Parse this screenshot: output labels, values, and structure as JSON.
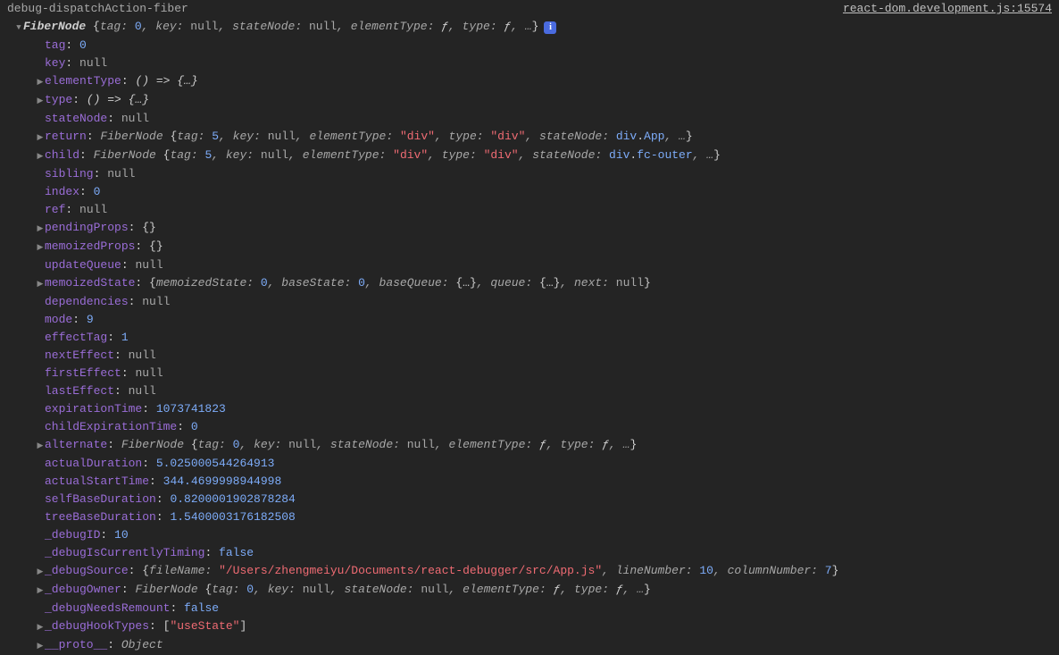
{
  "header": {
    "label": "debug-dispatchAction-fiber",
    "source": "react-dom.development.js:15574"
  },
  "root": {
    "cls": "FiberNode",
    "summary": [
      {
        "k": "tag",
        "t": "num",
        "v": "0"
      },
      {
        "k": "key",
        "t": "null",
        "v": "null"
      },
      {
        "k": "stateNode",
        "t": "null",
        "v": "null"
      },
      {
        "k": "elementType",
        "t": "fnsym",
        "v": "ƒ"
      },
      {
        "k": "type",
        "t": "fnsym",
        "v": "ƒ"
      },
      {
        "k": null,
        "t": "more",
        "v": "…"
      }
    ]
  },
  "props": [
    {
      "tri": "",
      "key": "tag",
      "value": [
        {
          "t": "num",
          "v": "0"
        }
      ]
    },
    {
      "tri": "",
      "key": "key",
      "value": [
        {
          "t": "null",
          "v": "null"
        }
      ]
    },
    {
      "tri": "▶",
      "key": "elementType",
      "value": [
        {
          "t": "fn",
          "v": "() => {…}"
        }
      ]
    },
    {
      "tri": "▶",
      "key": "type",
      "value": [
        {
          "t": "fn",
          "v": "() => {…}"
        }
      ]
    },
    {
      "tri": "",
      "key": "stateNode",
      "value": [
        {
          "t": "null",
          "v": "null"
        }
      ]
    },
    {
      "tri": "▶",
      "key": "return",
      "value": [
        {
          "t": "preview",
          "v": "FiberNode "
        },
        {
          "t": "punct",
          "v": "{"
        },
        {
          "t": "preview",
          "v": "tag: "
        },
        {
          "t": "num",
          "v": "5"
        },
        {
          "t": "preview",
          "v": ", key: "
        },
        {
          "t": "null",
          "v": "null"
        },
        {
          "t": "preview",
          "v": ", elementType: "
        },
        {
          "t": "str",
          "v": "\"div\""
        },
        {
          "t": "preview",
          "v": ", type: "
        },
        {
          "t": "str",
          "v": "\"div\""
        },
        {
          "t": "preview",
          "v": ", stateNode: "
        },
        {
          "t": "elem",
          "v": "div"
        },
        {
          "t": "punct",
          "v": "."
        },
        {
          "t": "cls",
          "v": "App"
        },
        {
          "t": "preview",
          "v": ", …"
        },
        {
          "t": "punct",
          "v": "}"
        }
      ]
    },
    {
      "tri": "▶",
      "key": "child",
      "value": [
        {
          "t": "preview",
          "v": "FiberNode "
        },
        {
          "t": "punct",
          "v": "{"
        },
        {
          "t": "preview",
          "v": "tag: "
        },
        {
          "t": "num",
          "v": "5"
        },
        {
          "t": "preview",
          "v": ", key: "
        },
        {
          "t": "null",
          "v": "null"
        },
        {
          "t": "preview",
          "v": ", elementType: "
        },
        {
          "t": "str",
          "v": "\"div\""
        },
        {
          "t": "preview",
          "v": ", type: "
        },
        {
          "t": "str",
          "v": "\"div\""
        },
        {
          "t": "preview",
          "v": ", stateNode: "
        },
        {
          "t": "elem",
          "v": "div"
        },
        {
          "t": "punct",
          "v": "."
        },
        {
          "t": "cls",
          "v": "fc-outer"
        },
        {
          "t": "preview",
          "v": ", …"
        },
        {
          "t": "punct",
          "v": "}"
        }
      ]
    },
    {
      "tri": "",
      "key": "sibling",
      "value": [
        {
          "t": "null",
          "v": "null"
        }
      ]
    },
    {
      "tri": "",
      "key": "index",
      "value": [
        {
          "t": "num",
          "v": "0"
        }
      ]
    },
    {
      "tri": "",
      "key": "ref",
      "value": [
        {
          "t": "null",
          "v": "null"
        }
      ]
    },
    {
      "tri": "▶",
      "key": "pendingProps",
      "value": [
        {
          "t": "punct",
          "v": "{}"
        }
      ]
    },
    {
      "tri": "▶",
      "key": "memoizedProps",
      "value": [
        {
          "t": "punct",
          "v": "{}"
        }
      ]
    },
    {
      "tri": "",
      "key": "updateQueue",
      "value": [
        {
          "t": "null",
          "v": "null"
        }
      ]
    },
    {
      "tri": "▶",
      "key": "memoizedState",
      "value": [
        {
          "t": "punct",
          "v": "{"
        },
        {
          "t": "preview",
          "v": "memoizedState: "
        },
        {
          "t": "num",
          "v": "0"
        },
        {
          "t": "preview",
          "v": ", baseState: "
        },
        {
          "t": "num",
          "v": "0"
        },
        {
          "t": "preview",
          "v": ", baseQueue: "
        },
        {
          "t": "punct",
          "v": "{…}"
        },
        {
          "t": "preview",
          "v": ", queue: "
        },
        {
          "t": "punct",
          "v": "{…}"
        },
        {
          "t": "preview",
          "v": ", next: "
        },
        {
          "t": "null",
          "v": "null"
        },
        {
          "t": "punct",
          "v": "}"
        }
      ]
    },
    {
      "tri": "",
      "key": "dependencies",
      "value": [
        {
          "t": "null",
          "v": "null"
        }
      ]
    },
    {
      "tri": "",
      "key": "mode",
      "value": [
        {
          "t": "num",
          "v": "9"
        }
      ]
    },
    {
      "tri": "",
      "key": "effectTag",
      "value": [
        {
          "t": "num",
          "v": "1"
        }
      ]
    },
    {
      "tri": "",
      "key": "nextEffect",
      "value": [
        {
          "t": "null",
          "v": "null"
        }
      ]
    },
    {
      "tri": "",
      "key": "firstEffect",
      "value": [
        {
          "t": "null",
          "v": "null"
        }
      ]
    },
    {
      "tri": "",
      "key": "lastEffect",
      "value": [
        {
          "t": "null",
          "v": "null"
        }
      ]
    },
    {
      "tri": "",
      "key": "expirationTime",
      "value": [
        {
          "t": "num",
          "v": "1073741823"
        }
      ]
    },
    {
      "tri": "",
      "key": "childExpirationTime",
      "value": [
        {
          "t": "num",
          "v": "0"
        }
      ]
    },
    {
      "tri": "▶",
      "key": "alternate",
      "value": [
        {
          "t": "preview",
          "v": "FiberNode "
        },
        {
          "t": "punct",
          "v": "{"
        },
        {
          "t": "preview",
          "v": "tag: "
        },
        {
          "t": "num",
          "v": "0"
        },
        {
          "t": "preview",
          "v": ", key: "
        },
        {
          "t": "null",
          "v": "null"
        },
        {
          "t": "preview",
          "v": ", stateNode: "
        },
        {
          "t": "null",
          "v": "null"
        },
        {
          "t": "preview",
          "v": ", elementType: "
        },
        {
          "t": "fnsym",
          "v": "ƒ"
        },
        {
          "t": "preview",
          "v": ", type: "
        },
        {
          "t": "fnsym",
          "v": "ƒ"
        },
        {
          "t": "preview",
          "v": ", …"
        },
        {
          "t": "punct",
          "v": "}"
        }
      ]
    },
    {
      "tri": "",
      "key": "actualDuration",
      "value": [
        {
          "t": "num",
          "v": "5.025000544264913"
        }
      ]
    },
    {
      "tri": "",
      "key": "actualStartTime",
      "value": [
        {
          "t": "num",
          "v": "344.4699998944998"
        }
      ]
    },
    {
      "tri": "",
      "key": "selfBaseDuration",
      "value": [
        {
          "t": "num",
          "v": "0.8200001902878284"
        }
      ]
    },
    {
      "tri": "",
      "key": "treeBaseDuration",
      "value": [
        {
          "t": "num",
          "v": "1.5400003176182508"
        }
      ]
    },
    {
      "tri": "",
      "key": "_debugID",
      "value": [
        {
          "t": "num",
          "v": "10"
        }
      ]
    },
    {
      "tri": "",
      "key": "_debugIsCurrentlyTiming",
      "value": [
        {
          "t": "bool",
          "v": "false"
        }
      ]
    },
    {
      "tri": "▶",
      "key": "_debugSource",
      "value": [
        {
          "t": "punct",
          "v": "{"
        },
        {
          "t": "preview",
          "v": "fileName: "
        },
        {
          "t": "str",
          "v": "\"/Users/zhengmeiyu/Documents/react-debugger/src/App.js\""
        },
        {
          "t": "preview",
          "v": ", lineNumber: "
        },
        {
          "t": "num",
          "v": "10"
        },
        {
          "t": "preview",
          "v": ", columnNumber: "
        },
        {
          "t": "num",
          "v": "7"
        },
        {
          "t": "punct",
          "v": "}"
        }
      ]
    },
    {
      "tri": "▶",
      "key": "_debugOwner",
      "value": [
        {
          "t": "preview",
          "v": "FiberNode "
        },
        {
          "t": "punct",
          "v": "{"
        },
        {
          "t": "preview",
          "v": "tag: "
        },
        {
          "t": "num",
          "v": "0"
        },
        {
          "t": "preview",
          "v": ", key: "
        },
        {
          "t": "null",
          "v": "null"
        },
        {
          "t": "preview",
          "v": ", stateNode: "
        },
        {
          "t": "null",
          "v": "null"
        },
        {
          "t": "preview",
          "v": ", elementType: "
        },
        {
          "t": "fnsym",
          "v": "ƒ"
        },
        {
          "t": "preview",
          "v": ", type: "
        },
        {
          "t": "fnsym",
          "v": "ƒ"
        },
        {
          "t": "preview",
          "v": ", …"
        },
        {
          "t": "punct",
          "v": "}"
        }
      ]
    },
    {
      "tri": "",
      "key": "_debugNeedsRemount",
      "value": [
        {
          "t": "bool",
          "v": "false"
        }
      ]
    },
    {
      "tri": "▶",
      "key": "_debugHookTypes",
      "value": [
        {
          "t": "punct",
          "v": "["
        },
        {
          "t": "str",
          "v": "\"useState\""
        },
        {
          "t": "punct",
          "v": "]"
        }
      ]
    },
    {
      "tri": "▶",
      "key": "__proto__",
      "value": [
        {
          "t": "preview",
          "v": "Object"
        }
      ]
    }
  ],
  "infoGlyph": "i"
}
